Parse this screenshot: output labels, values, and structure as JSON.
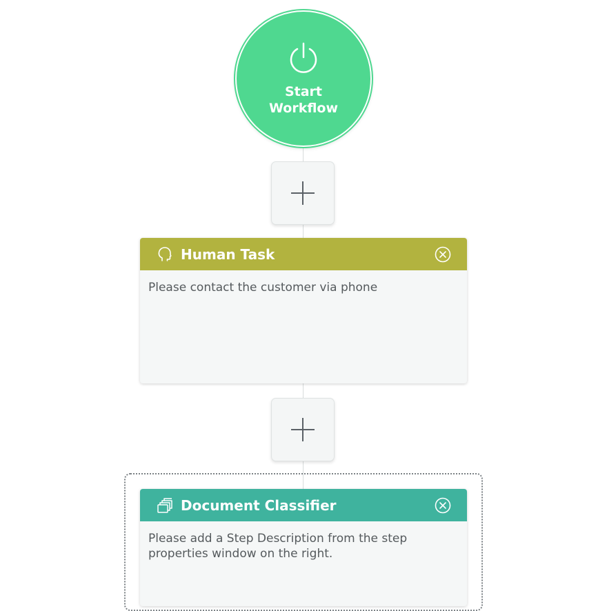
{
  "start_node": {
    "label": "Start Workflow",
    "icon": "power-icon",
    "color": "#4fd890"
  },
  "add_step_buttons": [
    {
      "icon": "plus-icon"
    },
    {
      "icon": "plus-icon"
    }
  ],
  "steps": [
    {
      "title": "Human Task",
      "icon": "head-icon",
      "header_color": "#b2b33f",
      "description": "Please contact the customer via phone",
      "close_icon": "close-circle-icon"
    },
    {
      "title": "Document Classifier",
      "icon": "documents-stack-icon",
      "header_color": "#3fb39e",
      "description": "Please add a Step Description from the step properties window on the right.",
      "close_icon": "close-circle-icon",
      "selected": true
    }
  ]
}
